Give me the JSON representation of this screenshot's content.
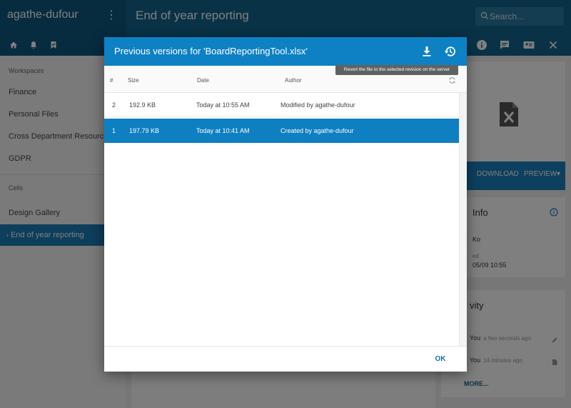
{
  "app": {
    "user_name": "agathe-dufour",
    "workspace_title": "End of year reporting",
    "search_placeholder": "Search..."
  },
  "sidebar": {
    "section_workspaces": "Workspaces",
    "workspaces": [
      "Finance",
      "Personal Files",
      "Cross Department Resources",
      "GDPR"
    ],
    "section_cells": "Cells",
    "cells": [
      "Design Gallery",
      "End of year reporting"
    ],
    "active_cell": "End of year reporting"
  },
  "right_panel": {
    "download_label": "DOWNLOAD",
    "preview_label": "PREVIEW",
    "info_title": "Info",
    "info_line1": "Ko",
    "info_line2": "ed",
    "info_line3": "05/09 10:55",
    "activity_title": "vity",
    "activities": [
      {
        "who": "You",
        "time": "a few seconds ago",
        "icon": "pencil-icon"
      },
      {
        "who": "You",
        "time": "14 minutes ago",
        "icon": "document-icon"
      }
    ],
    "more_label": "MORE..."
  },
  "dialog": {
    "title": "Previous versions for 'BoardReportingTool.xlsx'",
    "tooltip": "Revert the file to the selected revision on the server",
    "columns": {
      "num": "#",
      "size": "Size",
      "date": "Date",
      "author": "Author"
    },
    "rows": [
      {
        "num": "2",
        "size": "192.9 KB",
        "date": "Today at 10:55 AM",
        "author": "Modified by agathe-dufour",
        "selected": false
      },
      {
        "num": "1",
        "size": "197.79 KB",
        "date": "Today at 10:41 AM",
        "author": "Created by agathe-dufour",
        "selected": true
      }
    ],
    "ok_label": "OK"
  },
  "colors": {
    "header_blue": "#0e81c5",
    "selected_row": "#0e7fc1",
    "topbar": "#13658f"
  }
}
